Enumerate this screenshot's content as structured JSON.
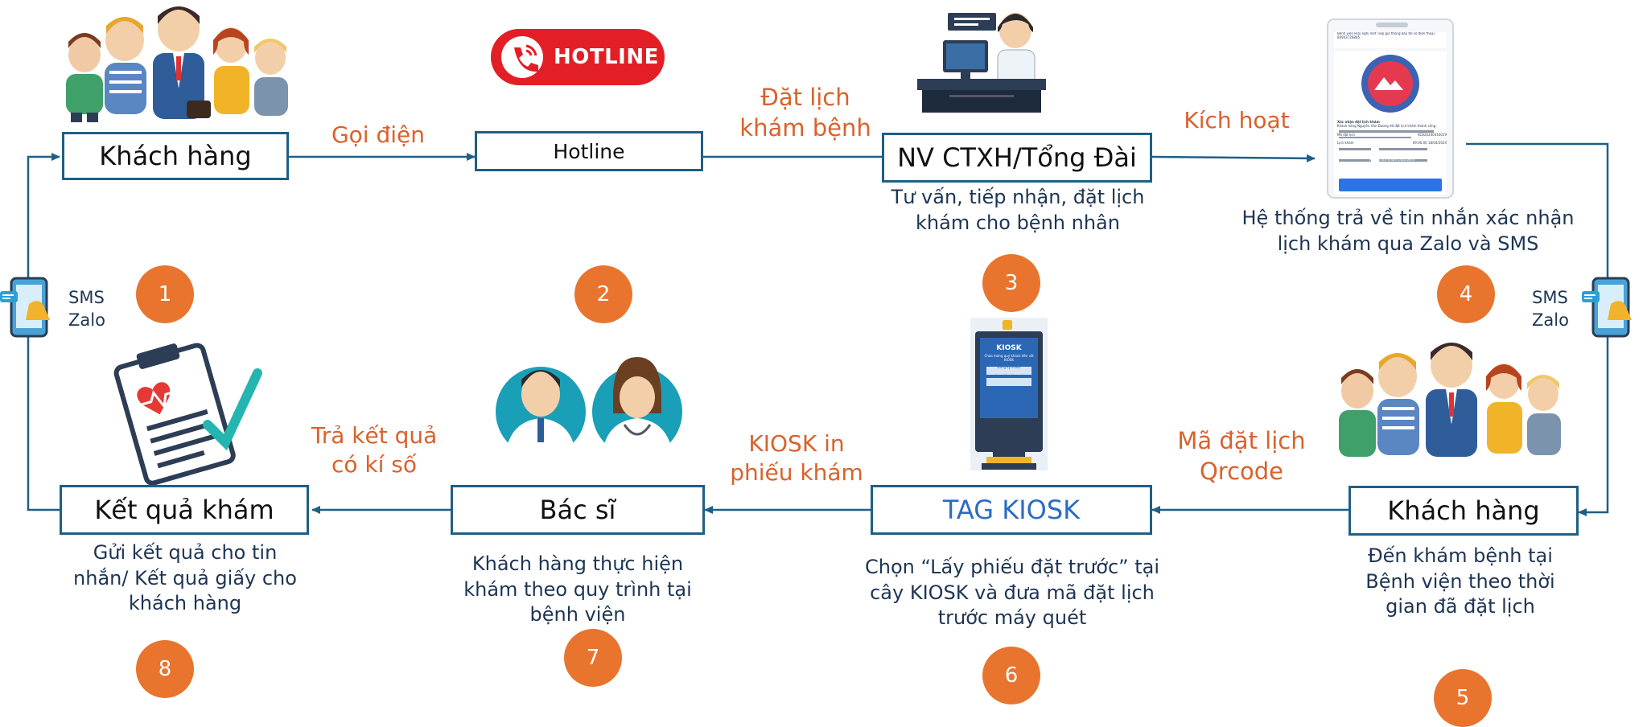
{
  "boxes": {
    "khach_hang_top": "Khách hàng",
    "hotline": "Hotline",
    "nv": "NV CTXH/Tổng Đài",
    "khach_hang_bottom": "Khách hàng",
    "tag_kiosk": "TAG KIOSK",
    "bac_si": "Bác sĩ",
    "ket_qua": "Kết quả khám"
  },
  "arrow_labels": {
    "goi_dien": "Gọi điện",
    "dat_lich_1": "Đặt lịch",
    "dat_lich_2": "khám bệnh",
    "kich_hoat": "Kích hoạt",
    "ma_dat_lich_1": "Mã đặt lịch",
    "ma_dat_lich_2": "Qrcode",
    "kiosk_in_1": "KIOSK in",
    "kiosk_in_2": "phiếu khám",
    "tra_kq_1": "Trả kết quả",
    "tra_kq_2": "có kí số"
  },
  "descriptions": {
    "nv_1": "Tư vấn, tiếp nhận, đặt lịch",
    "nv_2": "khám cho bệnh nhân",
    "he_thong_1": "Hệ thống trả về tin nhắn xác nhận",
    "he_thong_2": "lịch khám qua Zalo và SMS",
    "den_kham_1": "Đến khám bệnh tại",
    "den_kham_2": "Bệnh viện theo thời",
    "den_kham_3": "gian đã đặt lịch",
    "chon_1": "Chọn “Lấy phiếu đặt trước” tại",
    "chon_2": "cây KIOSK và đưa mã đặt lịch",
    "chon_3": "trước máy quét",
    "bs_1": "Khách hàng thực hiện",
    "bs_2": "khám theo quy trình tại",
    "bs_3": "bệnh viện",
    "kq_1": "Gửi kết quả cho tin",
    "kq_2": "nhắn/ Kết quả giấy cho",
    "kq_3": "khách hàng"
  },
  "steps": [
    "1",
    "2",
    "3",
    "4",
    "5",
    "6",
    "7",
    "8"
  ],
  "side_labels": {
    "left_sms": "SMS",
    "left_zalo": "Zalo",
    "right_sms": "SMS",
    "right_zalo": "Zalo"
  },
  "hotline_logo_text": "HOTLINE",
  "kiosk_screen": {
    "title": "KIOSK",
    "subtitle": "Chào mừng quý khách đến với KIOSK",
    "btn1": "Đăng ký khám",
    "btn2": "Lấy phiếu đặt trước"
  },
  "phone_message": {
    "header": "Bệnh viện Hữu nghị Việt Tiệp gửi thông báo tới số điện thoại 84943726805",
    "title": "Xác nhận đặt lịch khám",
    "body": "Khách hàng Nguyễn Văn Dương đã đặt lịch khám thành công.",
    "code_label": "Mã đặt lịch",
    "code_value": "KCB20240416019",
    "time_label": "Lịch khám",
    "time_value": "09:00:00 18/04/2024",
    "button": "Mã đặt lịch khám chữa bệnh"
  },
  "colors": {
    "box_border": "#1f5f86",
    "arrow": "#1f5f86",
    "orange_label": "#d9622b",
    "step_circle": "#e8742e",
    "kiosk_text": "#2b6cc4",
    "hotline_red": "#e21f26"
  }
}
